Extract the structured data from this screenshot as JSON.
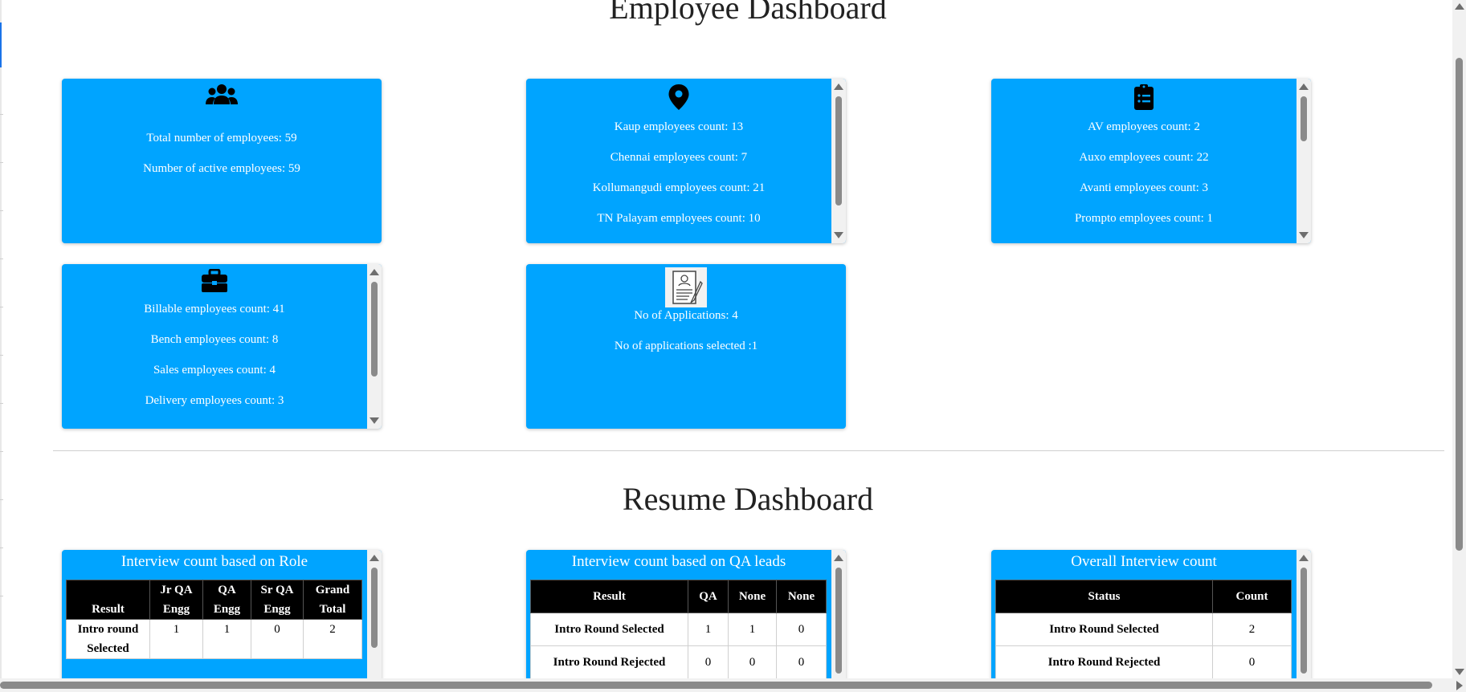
{
  "employee_dashboard": {
    "title": "Employee Dashboard",
    "cards": {
      "totals": {
        "icon": "users-icon",
        "lines": [
          "Total number of employees: 59",
          "Number of active employees: 59"
        ]
      },
      "locations": {
        "icon": "map-pin-icon",
        "lines": [
          "Kaup employees count: 13",
          "Chennai employees count: 7",
          "Kollumangudi employees count: 21",
          "TN Palayam employees count: 10"
        ]
      },
      "clients": {
        "icon": "clipboard-list-icon",
        "lines": [
          "AV employees count: 2",
          "Auxo employees count: 22",
          "Avanti employees count: 3",
          "Prompto employees count: 1"
        ]
      },
      "roles": {
        "icon": "briefcase-icon",
        "lines": [
          "Billable employees count: 41",
          "Bench employees count: 8",
          "Sales employees count: 4",
          "Delivery employees count: 3"
        ]
      },
      "applications": {
        "icon": "resume-document-icon",
        "lines": [
          "No of Applications: 4",
          "No of applications selected :1"
        ]
      }
    }
  },
  "resume_dashboard": {
    "title": "Resume Dashboard",
    "tables": {
      "by_role": {
        "title": "Interview count based on Role",
        "headers": [
          "Result",
          "Jr QA Engg",
          "QA Engg",
          "Sr QA Engg",
          "Grand Total"
        ],
        "rows": [
          [
            "Intro round Selected",
            "1",
            "1",
            "0",
            "2"
          ]
        ]
      },
      "by_qa_leads": {
        "title": "Interview count based on QA leads",
        "headers": [
          "Result",
          "QA",
          "None",
          "None"
        ],
        "rows": [
          [
            "Intro Round Selected",
            "1",
            "1",
            "0"
          ],
          [
            "Intro Round Rejected",
            "0",
            "0",
            "0"
          ]
        ]
      },
      "overall": {
        "title": "Overall Interview count",
        "headers": [
          "Status",
          "Count"
        ],
        "rows": [
          [
            "Intro Round Selected",
            "2"
          ],
          [
            "Intro Round Rejected",
            "0"
          ]
        ]
      }
    }
  },
  "colors": {
    "card_background": "#00a4ff",
    "table_header": "#000000",
    "card_text": "#ffffff"
  }
}
